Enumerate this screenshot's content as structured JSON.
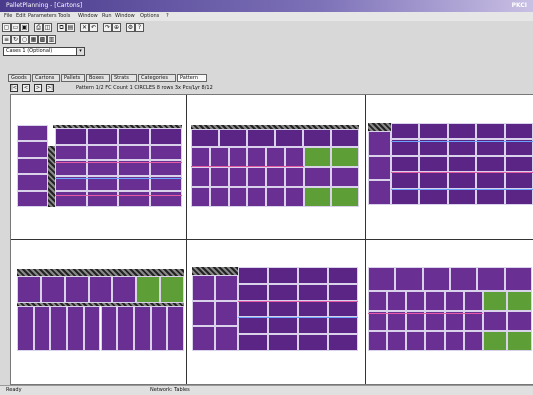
{
  "window": {
    "title": "PalletPlanning - [Cartons]",
    "corner_label": "PKCI"
  },
  "menu": [
    "File",
    "Edit",
    "Parameters",
    "Tools",
    "Window",
    "Run",
    "Window",
    "Options",
    "?"
  ],
  "toolbar1": [
    "new-icon",
    "open-icon",
    "save-icon",
    "print-icon",
    "preview-icon",
    "copy-icon",
    "paste-icon",
    "cut-icon",
    "undo-icon",
    "redo-icon",
    "zoom-icon",
    "settings-icon",
    "help-icon"
  ],
  "toolbar2": [
    "layer-icon",
    "rotate-icon",
    "circle-icon",
    "grid-icon",
    "pattern-icon",
    "stack-icon"
  ],
  "combo": {
    "value": "Cases 1 (Optional)"
  },
  "tabs": [
    "Goods",
    "Cartons",
    "Pallets",
    "Boxes",
    "Strats",
    "Categories",
    "Pattern"
  ],
  "active_tab": "Pattern",
  "nav": {
    "buttons": [
      "|<",
      "<",
      ">",
      ">|"
    ],
    "info": "Pattern 1/2  FC  Count 1 CIRCLES 8 rows  3x  Pcs/Lyr 8/12"
  },
  "status": {
    "left": "Ready",
    "middle": "Network: Tables"
  },
  "colors": {
    "carton": "#6a2f93",
    "carton_alt": "#5b2585",
    "highlight": "#5e9e36",
    "seam_a": "#e45aa6",
    "seam_b": "#6aa6ff"
  }
}
